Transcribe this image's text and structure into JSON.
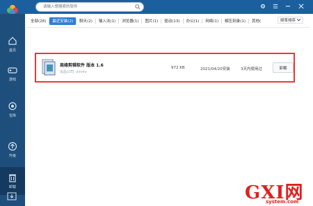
{
  "search": {
    "placeholder": "请输入想搜索的软件"
  },
  "tabs": [
    {
      "label": "全部(28)"
    },
    {
      "label": "最近安装(2)"
    },
    {
      "label": "聊天(2)"
    },
    {
      "label": "输入法(1)"
    },
    {
      "label": "浏览器(1)"
    },
    {
      "label": "图片(1)"
    },
    {
      "label": "驱动(13)"
    },
    {
      "label": "办公(1)"
    },
    {
      "label": "网络(1)"
    },
    {
      "label": "解压刻录(1)"
    },
    {
      "label": "其他("
    }
  ],
  "sort_label": "频率排序",
  "sidebar": [
    {
      "label": "首页",
      "icon": "home-icon"
    },
    {
      "label": "游戏",
      "icon": "gamepad-icon"
    },
    {
      "label": "宝库",
      "icon": "treasure-icon"
    },
    {
      "label": "升级",
      "icon": "upgrade-icon"
    },
    {
      "label": "卸载",
      "icon": "uninstall-icon"
    }
  ],
  "app": {
    "name": "商缘剪辑软件 版本 1.6",
    "publisher": "出品公司: xinntv",
    "size": "972 KB",
    "date": "2021/04/20安装",
    "frequency": "3天内使用过",
    "uninstall_label": "卸载"
  },
  "watermark": {
    "text": "GXI网",
    "sub": "system.com"
  },
  "colors": {
    "topbar": "#1b5f9e",
    "sidebar": "#1e4e7c",
    "sidebar_active": "#143a5f",
    "accent": "#2f7ed8",
    "highlight": "#e53935"
  }
}
